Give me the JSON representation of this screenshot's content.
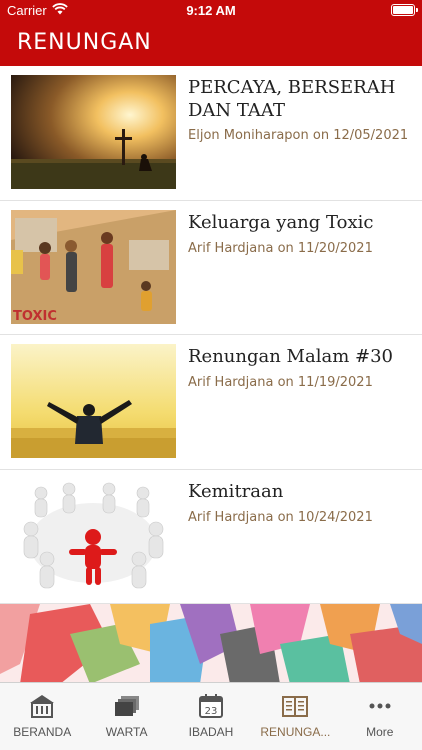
{
  "status_bar": {
    "carrier": "Carrier",
    "time": "9:12 AM"
  },
  "nav": {
    "title": "RENUNGAN"
  },
  "articles": [
    {
      "title": "PERCAYA, BERSERAH DAN TAAT",
      "author": "Eljon Moniharapon",
      "date": "12/05/2021",
      "meta": "Eljon Moniharapon on 12/05/2021"
    },
    {
      "title": "Keluarga yang Toxic",
      "author": "Arif Hardjana",
      "date": "11/20/2021",
      "meta": "Arif Hardjana on 11/20/2021",
      "image_text": "TOXIC"
    },
    {
      "title": "Renungan Malam #30",
      "author": "Arif Hardjana",
      "date": "11/19/2021",
      "meta": "Arif Hardjana on 11/19/2021"
    },
    {
      "title": "Kemitraan",
      "author": "Arif Hardjana",
      "date": "10/24/2021",
      "meta": "Arif Hardjana on 10/24/2021"
    }
  ],
  "tabs": [
    {
      "label": "BERANDA",
      "icon": "church-icon",
      "active": false
    },
    {
      "label": "WARTA",
      "icon": "stack-icon",
      "active": false
    },
    {
      "label": "IBADAH",
      "icon": "calendar-icon",
      "active": false,
      "calendar_day": "23"
    },
    {
      "label": "RENUNGA...",
      "icon": "book-icon",
      "active": true
    },
    {
      "label": "More",
      "icon": "more-icon",
      "active": false
    }
  ],
  "colors": {
    "brand": "#c40a0a",
    "meta_text": "#8a6c4a",
    "active_tab": "#8a6c4a"
  }
}
